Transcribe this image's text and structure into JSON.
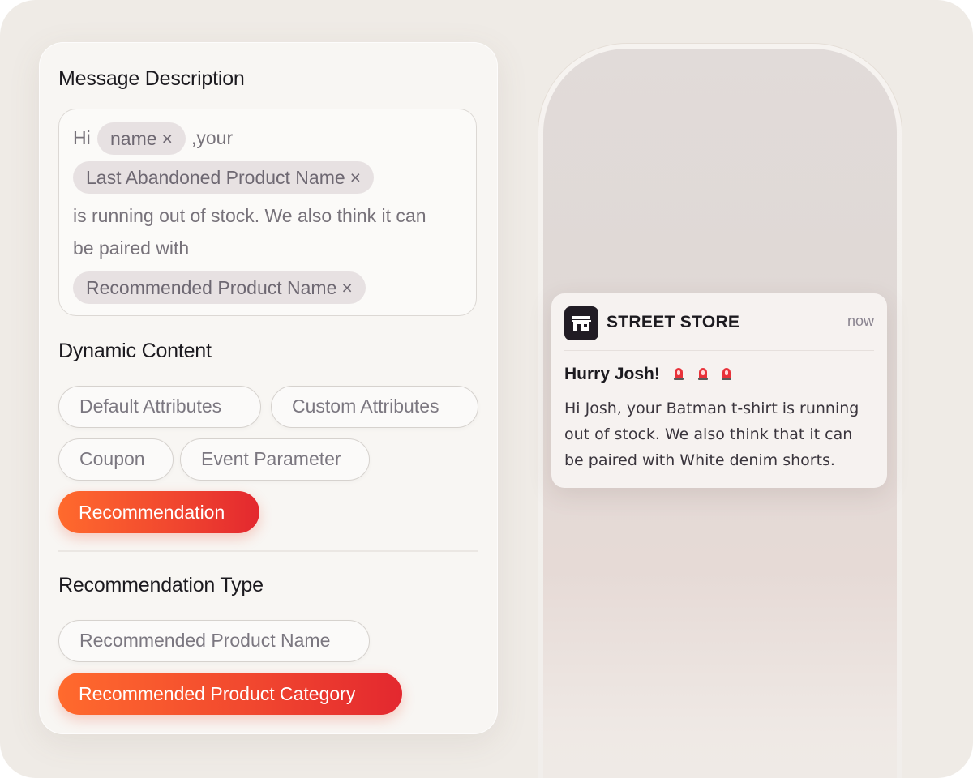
{
  "editor": {
    "message_title": "Message Description",
    "message": {
      "greeting": "Hi",
      "token_name": "name",
      "after_name": ",your",
      "token_last_product": "Last Abandoned Product Name",
      "line3": "is running out of stock. We also think it can",
      "line4": "be paired with",
      "token_recommended": "Recommended Product Name",
      "remove_glyph": "×"
    },
    "dynamic_title": "Dynamic Content",
    "dynamic_options": [
      "Default Attributes",
      "Custom Attributes",
      "Coupon",
      "Event Parameter",
      "Recommendation"
    ],
    "dynamic_selected": "Recommendation",
    "rec_type_title": "Recommendation Type",
    "rec_type_options": [
      "Recommended Product Name",
      "Recommended Product Category"
    ],
    "rec_type_selected": "Recommended Product Category"
  },
  "notification": {
    "app_name": "STREET STORE",
    "time": "now",
    "title": "Hurry Josh!",
    "title_icons": [
      "siren-icon",
      "siren-icon",
      "siren-icon"
    ],
    "body": "Hi Josh, your Batman t-shirt is running out of stock. We also think that it can be paired with White denim shorts.",
    "app_icon": "store-icon"
  },
  "colors": {
    "accent_start": "#ff6a2d",
    "accent_end": "#e3282f",
    "background": "#efebe6",
    "token_bg": "#e7e1e2",
    "app_icon_bg": "#211c24"
  }
}
